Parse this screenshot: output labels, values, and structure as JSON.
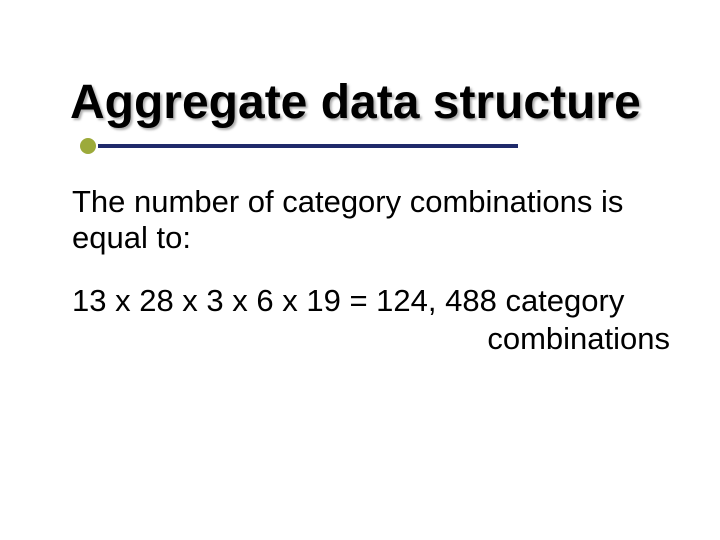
{
  "slide": {
    "title": "Aggregate data structure",
    "intro": "The number of category combinations is equal to:",
    "calc_line1": "13 x 28 x 3 x 6 x 19 = 124, 488 category",
    "calc_line2": "combinations"
  }
}
